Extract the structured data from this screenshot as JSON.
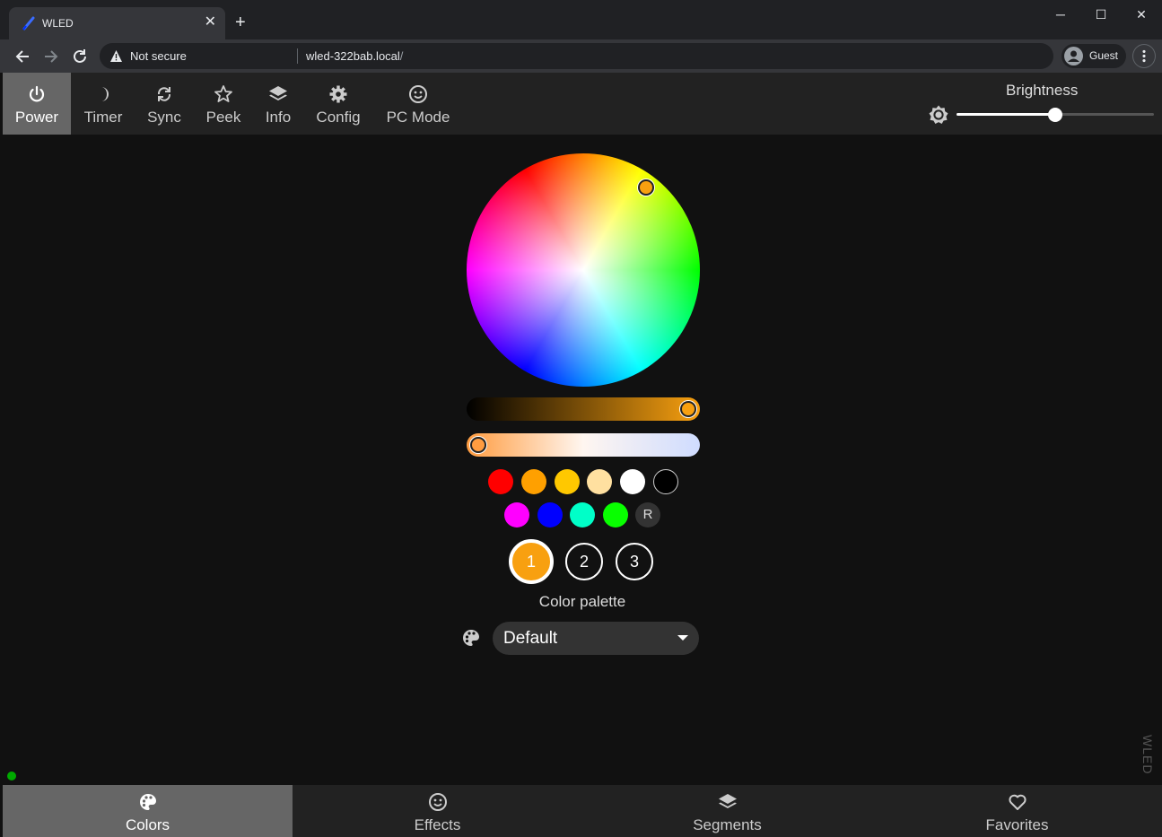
{
  "browser": {
    "tab_title": "WLED",
    "tab_close": "✕",
    "new_tab": "+",
    "security_label": "Not secure",
    "url_host": "wled-322bab.local",
    "url_path": "/",
    "profile_name": "Guest",
    "window_buttons": {
      "minimize": "─",
      "maximize": "☐",
      "close": "✕"
    }
  },
  "topbar": {
    "buttons": [
      {
        "label": "Power",
        "icon": "power-icon",
        "active": true
      },
      {
        "label": "Timer",
        "icon": "moon-icon",
        "active": false
      },
      {
        "label": "Sync",
        "icon": "sync-icon",
        "active": false
      },
      {
        "label": "Peek",
        "icon": "star-icon",
        "active": false
      },
      {
        "label": "Info",
        "icon": "layers-icon",
        "active": false
      },
      {
        "label": "Config",
        "icon": "gear-icon",
        "active": false
      },
      {
        "label": "PC Mode",
        "icon": "smiley-icon",
        "active": false
      }
    ],
    "brightness": {
      "label": "Brightness",
      "value": 0.5
    }
  },
  "colors": {
    "selected_color": "#f8a010",
    "wheel": {
      "hue": 38,
      "saturation": 0.95
    },
    "value_slider": 1.0,
    "kelvin_slider": 0.0,
    "quick_colors_row1": [
      "#ff0000",
      "#ffa000",
      "#ffc800",
      "#ffe0a0",
      "#ffffff",
      "#000000"
    ],
    "quick_colors_row2": [
      "#ff00ff",
      "#0000ff",
      "#00ffc8",
      "#08ff00"
    ],
    "random_label": "R",
    "slots": [
      "1",
      "2",
      "3"
    ],
    "active_slot": 0,
    "palette_label": "Color palette",
    "palette_value": "Default"
  },
  "watermark": "WLED",
  "bottombar": {
    "tabs": [
      {
        "label": "Colors",
        "icon": "palette-icon",
        "active": true
      },
      {
        "label": "Effects",
        "icon": "smiley-icon",
        "active": false
      },
      {
        "label": "Segments",
        "icon": "layers-icon",
        "active": false
      },
      {
        "label": "Favorites",
        "icon": "heart-icon",
        "active": false
      }
    ]
  }
}
